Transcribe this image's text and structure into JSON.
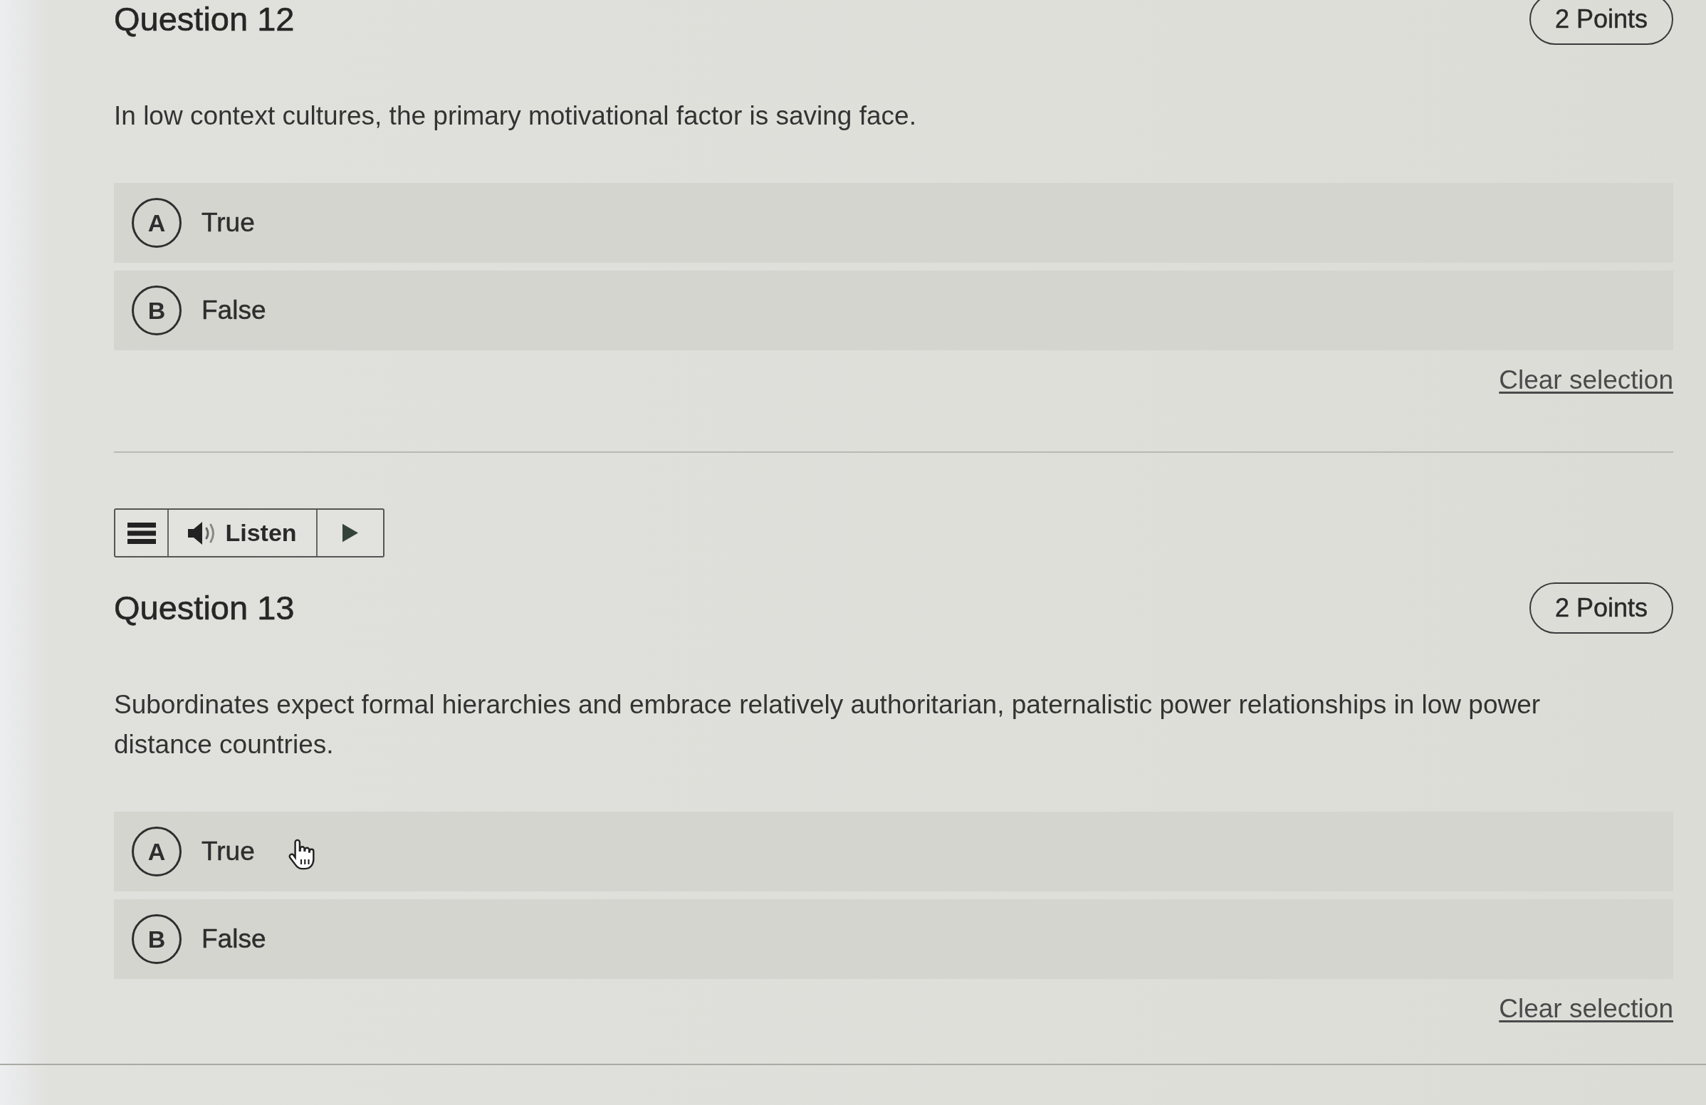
{
  "questions": [
    {
      "title": "Question 12",
      "points": "2 Points",
      "prompt": "In low context cultures, the primary motivational factor is saving face.",
      "options": [
        {
          "letter": "A",
          "label": "True",
          "selected": false,
          "hovered": false
        },
        {
          "letter": "B",
          "label": "False",
          "selected": false,
          "hovered": false
        }
      ],
      "clear_link": "Clear selection"
    },
    {
      "listen_bar": {
        "label": "Listen"
      },
      "title": "Question 13",
      "points": "2 Points",
      "prompt": "Subordinates expect formal hierarchies and embrace relatively authoritarian, paternalistic power relationships in low power distance countries.",
      "options": [
        {
          "letter": "A",
          "label": "True",
          "selected": false,
          "hovered": true
        },
        {
          "letter": "B",
          "label": "False",
          "selected": false,
          "hovered": false
        }
      ],
      "clear_link": "Clear selection"
    }
  ]
}
